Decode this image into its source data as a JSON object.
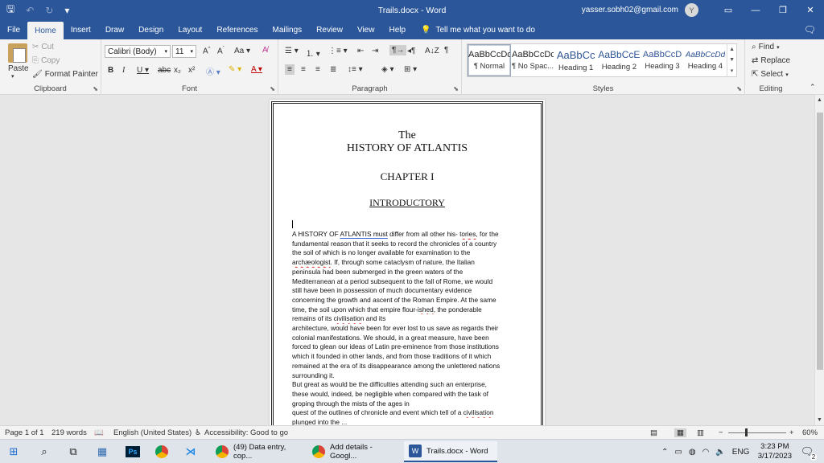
{
  "window": {
    "title": "Trails.docx  -  Word",
    "user_email": "yasser.sobh02@gmail.com",
    "avatar_initial": "Y"
  },
  "tabs": [
    "File",
    "Home",
    "Insert",
    "Draw",
    "Design",
    "Layout",
    "References",
    "Mailings",
    "Review",
    "View",
    "Help"
  ],
  "tell_me": "Tell me what you want to do",
  "clipboard": {
    "paste": "Paste",
    "cut": "Cut",
    "copy": "Copy",
    "format_painter": "Format Painter",
    "label": "Clipboard"
  },
  "font": {
    "name": "Calibri (Body)",
    "size": "11",
    "change_case": "Aa",
    "label": "Font"
  },
  "paragraph": {
    "label": "Paragraph"
  },
  "styles": {
    "label": "Styles",
    "items": [
      {
        "preview": "AaBbCcDc",
        "name": "¶ Normal",
        "selected": true
      },
      {
        "preview": "AaBbCcDc",
        "name": "¶ No Spac...",
        "selected": false
      },
      {
        "preview": "AaBbCc",
        "name": "Heading 1",
        "selected": false
      },
      {
        "preview": "AaBbCcE",
        "name": "Heading 2",
        "selected": false
      },
      {
        "preview": "AaBbCcD",
        "name": "Heading 3",
        "selected": false
      },
      {
        "preview": "AaBbCcDd",
        "name": "Heading 4",
        "selected": false
      }
    ]
  },
  "editing": {
    "find": "Find",
    "replace": "Replace",
    "select": "Select",
    "label": "Editing"
  },
  "document": {
    "title_line1": "The",
    "title_line2": "HISTORY OF ATLANTIS",
    "chapter": "CHAPTER I",
    "section": "INTRODUCTORY",
    "lines": [
      [
        "A HISTORY OF ",
        {
          "t": "ATLANTIS  must",
          "u": "gr"
        },
        " differ from all other his- ",
        {
          "t": "tories",
          "u": "sp"
        },
        ", for the"
      ],
      [
        "fundamental reason that it seeks to record the chronicles of a country"
      ],
      [
        "the soil of which is no longer available for examination to the"
      ],
      [
        {
          "t": "archæologist",
          "u": "sp"
        },
        ". If, through some cataclysm of nature, the Italian"
      ],
      [
        "peninsula had been submerged in the green waters of the"
      ],
      [
        "Mediterranean at a period subsequent to the fall of Rome, we would"
      ],
      [
        "still have been in possession of much documentary evidence"
      ],
      [
        "concerning the growth and ascent of the Roman Empire. At the same"
      ],
      [
        "time, the soil upon which that empire flour-",
        {
          "t": "ished",
          "u": "sp"
        },
        ", the ponderable"
      ],
      [
        "remains of its ",
        {
          "t": "civilisation",
          "u": "sp"
        },
        " and its"
      ],
      [
        "architecture, would have been for ever lost to us save as regards their"
      ],
      [
        "colonial manifestations. We should, in a great measure, have been"
      ],
      [
        "forced to glean our ideas of Latin pre-eminence from those institutions"
      ],
      [
        "which it founded in other lands, and from those traditions of it which"
      ],
      [
        "remained at the era of its disappearance among the unlettered nations"
      ],
      [
        "surrounding it."
      ],
      [
        "But great as would be the difficulties attending such an enterprise,"
      ],
      [
        "these would, indeed, be negligible when compared with the task of"
      ],
      [
        "groping through the mists of the ages in"
      ],
      [
        "quest of the outlines of chronicle and event which tell of a ",
        {
          "t": "civilisation",
          "u": "sp"
        }
      ],
      [
        "plunged into the ",
        {
          "t": "...",
          "u": "gr"
        }
      ]
    ]
  },
  "status": {
    "page": "Page 1 of 1",
    "words": "219 words",
    "language": "English (United States)",
    "accessibility": "Accessibility: Good to go",
    "zoom": "60%"
  },
  "taskbar": {
    "apps": [
      {
        "label": "(49) Data entry, cop...",
        "color": "#e8a43a"
      },
      {
        "label": "Add details - Googl...",
        "color": "#e8a43a"
      },
      {
        "label": "Trails.docx - Word",
        "color": "#2b579a"
      }
    ],
    "language": "ENG",
    "time": "3:23 PM",
    "date": "3/17/2023",
    "notification_count": "2"
  }
}
